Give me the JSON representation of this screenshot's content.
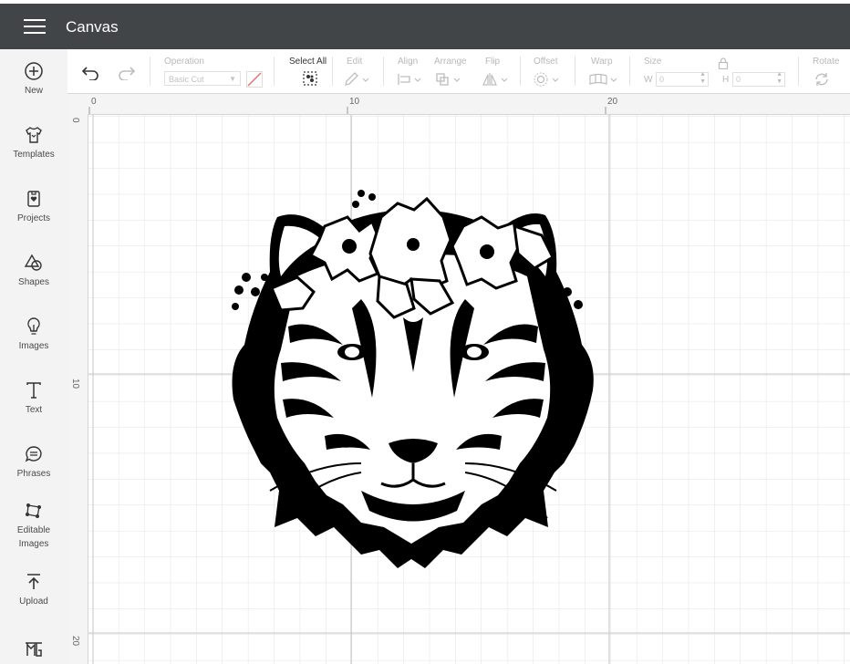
{
  "header": {
    "title": "Canvas"
  },
  "sidebar": {
    "items": [
      {
        "label": "New",
        "icon": "plus-circle-icon"
      },
      {
        "label": "Templates",
        "icon": "tshirt-icon"
      },
      {
        "label": "Projects",
        "icon": "project-tag-icon"
      },
      {
        "label": "Shapes",
        "icon": "shapes-icon"
      },
      {
        "label": "Images",
        "icon": "lightbulb-icon"
      },
      {
        "label": "Text",
        "icon": "text-icon"
      },
      {
        "label": "Phrases",
        "icon": "speech-bubble-icon"
      },
      {
        "label": "Editable",
        "label2": "Images",
        "icon": "editable-image-icon"
      },
      {
        "label": "Upload",
        "icon": "upload-icon"
      },
      {
        "label": "",
        "icon": "monogram-icon"
      }
    ]
  },
  "toolbar": {
    "operation_label": "Operation",
    "operation_value": "Basic Cut",
    "select_all_label": "Select All",
    "edit_label": "Edit",
    "align_label": "Align",
    "arrange_label": "Arrange",
    "flip_label": "Flip",
    "offset_label": "Offset",
    "warp_label": "Warp",
    "size_label": "Size",
    "width_label": "W",
    "width_value": "0",
    "height_label": "H",
    "height_value": "0",
    "rotate_label": "Rotate"
  },
  "rulers": {
    "top": [
      "0",
      "10",
      "20"
    ],
    "left": [
      "0",
      "10",
      "20"
    ]
  },
  "colors": {
    "header_bg": "#414548",
    "sidebar_bg": "#f3f3f3",
    "grid_minor": "#e0e0e0",
    "grid_major": "#c9c9c9"
  }
}
